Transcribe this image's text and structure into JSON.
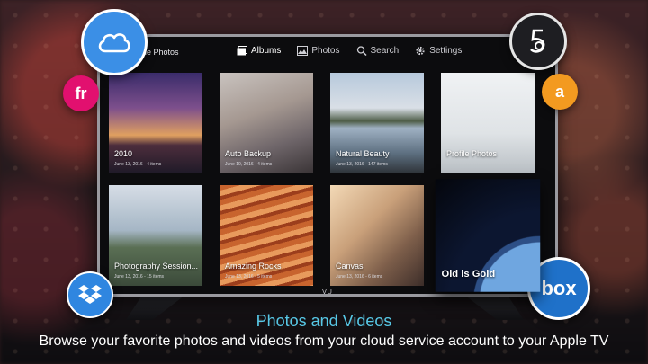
{
  "nav": {
    "app_title": "le Photos",
    "items": [
      {
        "label": "Albums",
        "icon": "albums-icon",
        "active": true
      },
      {
        "label": "Photos",
        "icon": "photos-icon",
        "active": false
      },
      {
        "label": "Search",
        "icon": "search-icon",
        "active": false
      },
      {
        "label": "Settings",
        "icon": "gear-icon",
        "active": false
      }
    ]
  },
  "albums": [
    {
      "title": "2010",
      "meta": "June 13, 2016 - 4 items"
    },
    {
      "title": "Auto Backup",
      "meta": "June 10, 2016 - 4 items"
    },
    {
      "title": "Natural Beauty",
      "meta": "June 13, 2016 - 147 items"
    },
    {
      "title": "Profile Photos",
      "meta": ""
    },
    {
      "title": "Photography Session...",
      "meta": "June 13, 2016 - 15 items"
    },
    {
      "title": "Amazing Rocks",
      "meta": "June 13, 2016 - 5 items"
    },
    {
      "title": "Canvas",
      "meta": "June 13, 2016 - 6 items"
    },
    {
      "title": "Old is Gold",
      "meta": ""
    }
  ],
  "tv_brand": "VU",
  "badges": {
    "fr": "fr",
    "amazon": "a",
    "box": "box"
  },
  "caption": {
    "title": "Photos and Videos",
    "subtitle": "Browse your favorite photos and videos from your cloud service account to your Apple TV"
  },
  "colors": {
    "accent_caption": "#57c8e6",
    "cloud_badge": "#3b8fe6",
    "fr_badge": "#e2106f",
    "amazon_badge": "#f39a20",
    "box_badge": "#1f71c9",
    "dropbox_badge": "#2f86e0"
  }
}
